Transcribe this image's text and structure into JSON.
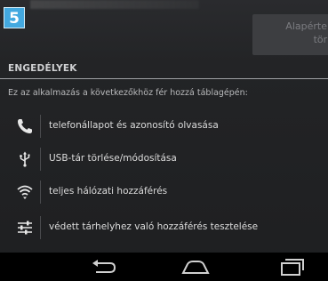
{
  "badge": {
    "step": "5"
  },
  "defaults_button": {
    "label": "Alapérteln\ntörlé"
  },
  "permissions": {
    "header": "ENGEDÉLYEK",
    "description": "Ez az alkalmazás a következőkhöz fér hozzá táblagépén:",
    "items": [
      {
        "icon": "phone-icon",
        "label": "telefonállapot és azonosító olvasása"
      },
      {
        "icon": "usb-icon",
        "label": "USB-tár törlése/módosítása"
      },
      {
        "icon": "wifi-icon",
        "label": "teljes hálózati hozzáférés"
      },
      {
        "icon": "sliders-icon",
        "label": "védett tárhelyhez való hozzáférés tesztelése"
      }
    ]
  },
  "nav": {
    "buttons": [
      {
        "icon": "back-icon"
      },
      {
        "icon": "home-icon"
      },
      {
        "icon": "recent-apps-icon"
      }
    ]
  },
  "colors": {
    "badge": "#43a9e0",
    "background": "#1c1d1f",
    "nav_bar": "#000000"
  }
}
